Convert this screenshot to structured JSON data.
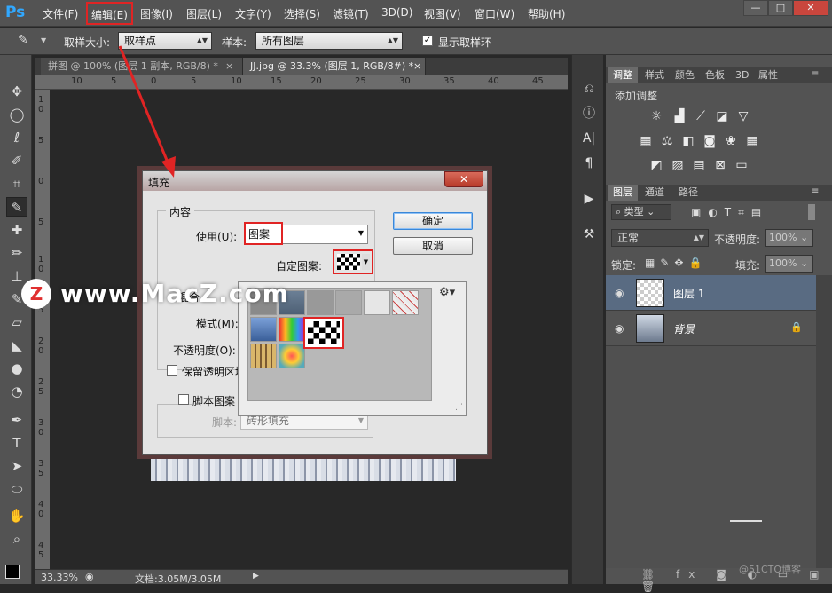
{
  "menubar": {
    "logo": "Ps",
    "items": [
      "文件(F)",
      "编辑(E)",
      "图像(I)",
      "图层(L)",
      "文字(Y)",
      "选择(S)",
      "滤镜(T)",
      "3D(D)",
      "视图(V)",
      "窗口(W)",
      "帮助(H)"
    ],
    "win_min": "—",
    "win_max": "□",
    "win_close": "✕"
  },
  "options": {
    "sample_size_label": "取样大小:",
    "sample_size_value": "取样点",
    "sample_label": "样本:",
    "sample_value": "所有图层",
    "show_ring_label": "显示取样环"
  },
  "tabs": [
    "拼图 @ 100% (图层 1 副本, RGB/8) *",
    "JJ.jpg @ 33.3% (图层 1, RGB/8#) *"
  ],
  "ruler_h": [
    "10",
    "5",
    "0",
    "5",
    "10",
    "15",
    "20",
    "25",
    "30",
    "35",
    "40",
    "45"
  ],
  "ruler_v": [
    "1 0",
    "5",
    "0",
    "5",
    "1 0",
    "1 5",
    "2 0",
    "2 5",
    "3 0",
    "3 5",
    "4 0",
    "4 5"
  ],
  "status": {
    "zoom": "33.33%",
    "doc": "文档:3.05M/3.05M"
  },
  "adjust_panel": {
    "tabs": [
      "调整",
      "样式",
      "颜色",
      "色板",
      "3D",
      "属性"
    ],
    "add_label": "添加调整"
  },
  "layers_panel": {
    "tabs": [
      "图层",
      "通道",
      "路径"
    ],
    "kind": "类型",
    "blend": "正常",
    "opacity_label": "不透明度:",
    "opacity_value": "100%",
    "lock_label": "锁定:",
    "fill_label": "填充:",
    "fill_value": "100%",
    "layers": [
      {
        "name": "图层 1",
        "selected": true
      },
      {
        "name": "背景",
        "locked": true
      }
    ]
  },
  "watermark": "www.MacZ.com",
  "watermark_logo": "Z",
  "corner_credit": "@51CTO博客",
  "dialog": {
    "title": "填充",
    "close": "✕",
    "ok": "确定",
    "cancel": "取消",
    "content_legend": "内容",
    "use_label": "使用(U):",
    "use_value": "图案",
    "custom_pattern_label": "自定图案:",
    "blend_partial": "混合",
    "mode_label": "模式(M):",
    "opacity_label": "不透明度(O):",
    "preserve_label": "保留透明区域",
    "script_label": "脚本图案",
    "script_field_label": "脚本:",
    "script_value": "砖形填充"
  },
  "colors": {
    "highlight": "#e02424",
    "selected_layer": "#596b82"
  }
}
